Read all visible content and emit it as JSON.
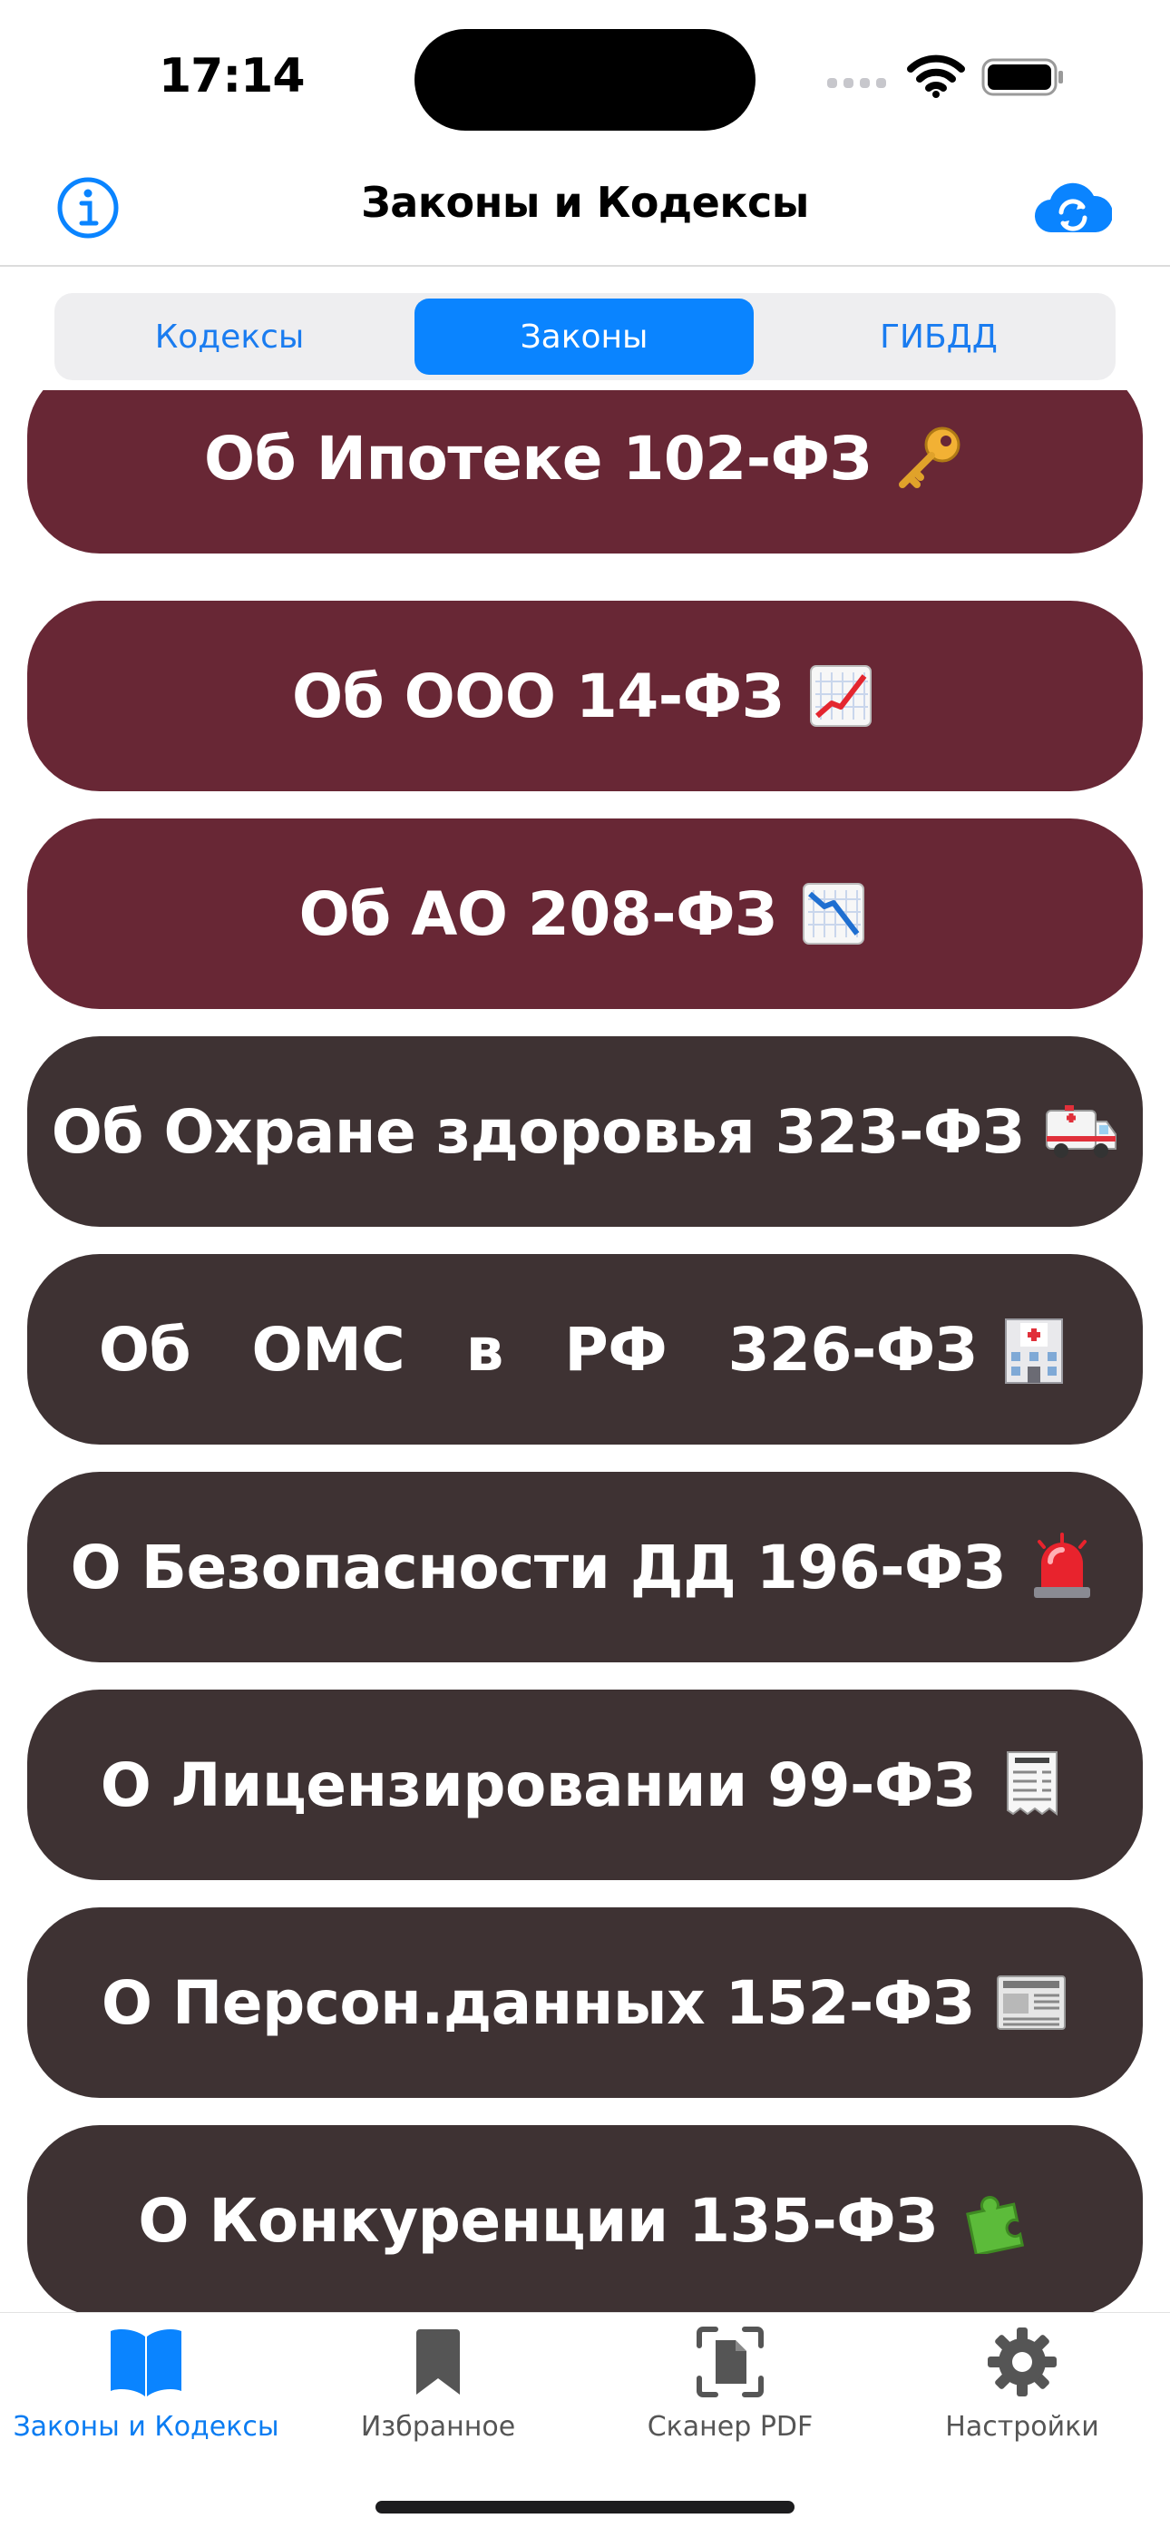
{
  "status_bar": {
    "time": "17:14"
  },
  "nav": {
    "title": "Законы и Кодексы"
  },
  "segments": [
    {
      "label": "Кодексы",
      "selected": false
    },
    {
      "label": "Законы",
      "selected": true
    },
    {
      "label": "ГИБДД",
      "selected": false
    }
  ],
  "laws": [
    {
      "label": "Об Ипотеке 102-ФЗ",
      "icon": "key-icon",
      "color": "#682735"
    },
    {
      "label": "Об ООО 14-ФЗ",
      "icon": "chart-up-icon",
      "color": "#682735"
    },
    {
      "label": "Об АО 208-ФЗ",
      "icon": "chart-down-icon",
      "color": "#682735"
    },
    {
      "label": "Об Охране здоровья 323-ФЗ",
      "icon": "ambulance-icon",
      "color": "#3e3233"
    },
    {
      "label": "Об   ОМС   в   РФ   326-ФЗ",
      "icon": "hospital-icon",
      "color": "#3e3233"
    },
    {
      "label": "О Безопасности ДД 196-ФЗ",
      "icon": "siren-icon",
      "color": "#3e3233"
    },
    {
      "label": "О Лицензировании 99-ФЗ",
      "icon": "receipt-icon",
      "color": "#3e3233"
    },
    {
      "label": "О Персон.данных 152-ФЗ",
      "icon": "newspaper-icon",
      "color": "#3e3233"
    },
    {
      "label": "О Конкуренции 135-ФЗ",
      "icon": "puzzle-icon",
      "color": "#3e3233"
    }
  ],
  "tabs": [
    {
      "label": "Законы и Кодексы",
      "icon": "book-icon",
      "selected": true
    },
    {
      "label": "Избранное",
      "icon": "bookmark-icon",
      "selected": false
    },
    {
      "label": "Сканер PDF",
      "icon": "document-scanner-icon",
      "selected": false
    },
    {
      "label": "Настройки",
      "icon": "gear-icon",
      "selected": false
    }
  ],
  "colors": {
    "accent": "#0a84ff",
    "maroon": "#682735",
    "dark": "#3e3233"
  }
}
